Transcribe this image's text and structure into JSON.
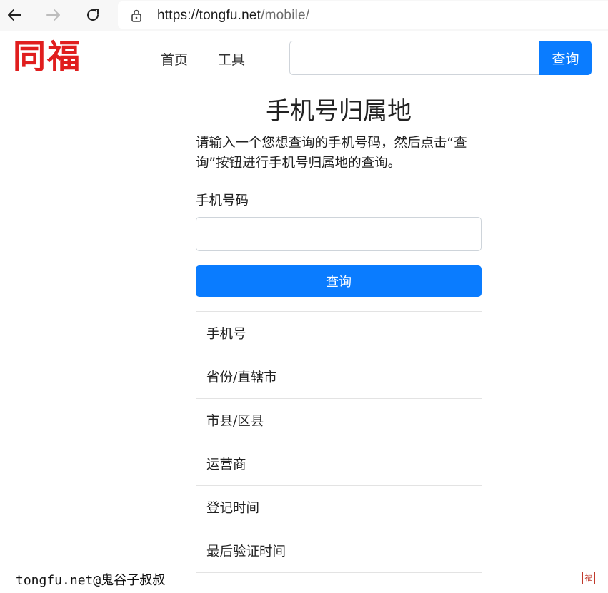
{
  "browser": {
    "url_host": "https://tongfu.net",
    "url_path": "/mobile/"
  },
  "header": {
    "logo_text": "同福",
    "nav": [
      "首页",
      "工具"
    ],
    "search_button": "查询"
  },
  "main": {
    "title": "手机号归属地",
    "intro": "请输入一个您想查询的手机号码，然后点击“查询”按钮进行手机号归属地的查询。",
    "field_label": "手机号码",
    "phone_value": "",
    "query_button": "查询",
    "results": [
      "手机号",
      "省份/直辖市",
      "市县/区县",
      "运营商",
      "登记时间",
      "最后验证时间"
    ]
  },
  "watermark": {
    "text": "tongfu.net@鬼谷子叔叔",
    "seal": "福"
  },
  "colors": {
    "accent": "#0a7cff",
    "logo": "#e01e1e"
  },
  "icons": [
    "back-arrow-icon",
    "forward-arrow-icon",
    "reload-icon",
    "lock-icon"
  ]
}
